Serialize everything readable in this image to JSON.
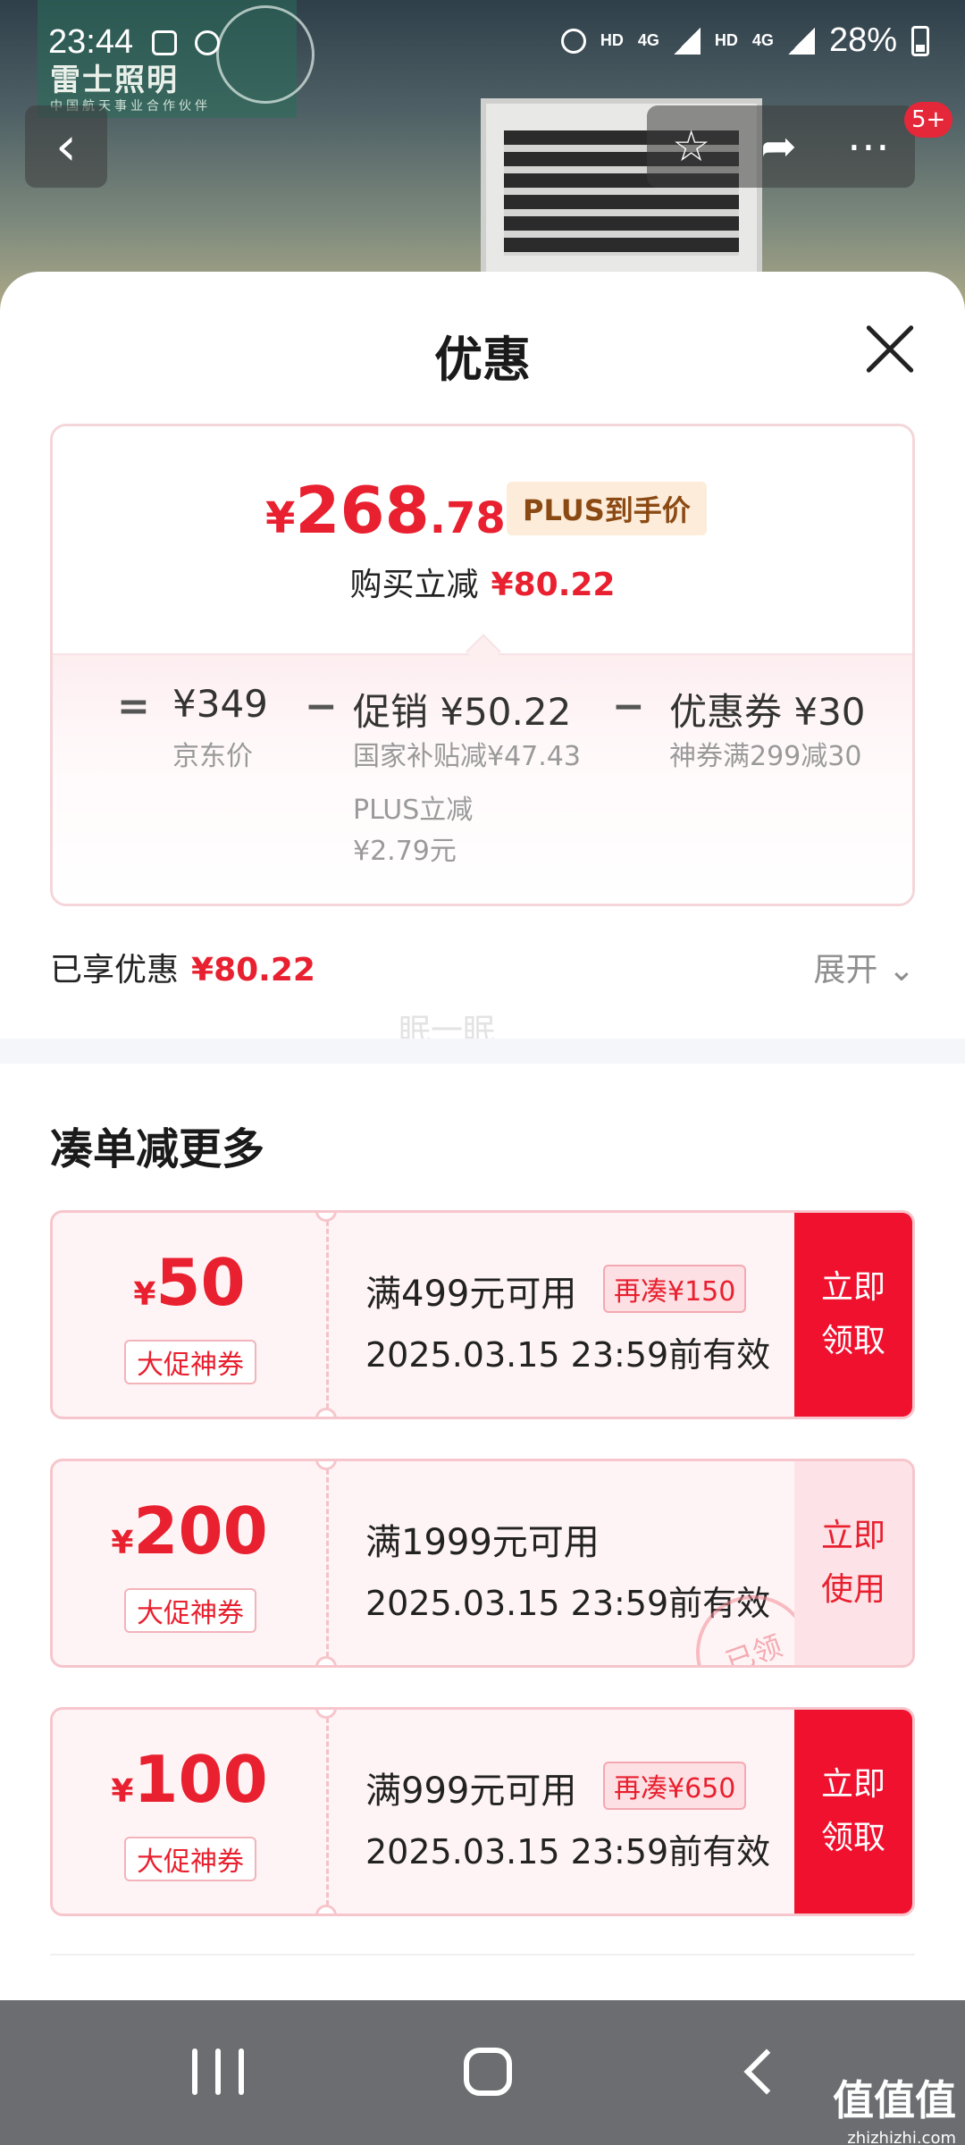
{
  "status_bar": {
    "time": "23:44",
    "network_1": "HD",
    "network_2": "4G",
    "network_3": "HD",
    "network_4": "4G",
    "battery": "28%"
  },
  "background": {
    "brand_logo": "雷士照明",
    "brand_tagline": "中国航天事业合作伙伴",
    "cart_badge": "5+"
  },
  "sheet": {
    "title": "优惠"
  },
  "price_card": {
    "yen": "¥",
    "final_price_int": "268",
    "final_price_dec": ".78",
    "plus_tag": "PLUS到手价",
    "saved_label": "购买立减",
    "saved_value": "¥80.22",
    "equals": "=",
    "minus": "−",
    "jd_price": "¥349",
    "jd_label": "京东价",
    "promo": "促销 ¥50.22",
    "promo_sub1": "国家补贴减¥47.43",
    "promo_sub2": "PLUS立减",
    "promo_sub3": "¥2.79元",
    "coupon": "优惠券 ¥30",
    "coupon_sub": "神券满299减30"
  },
  "enjoyed": {
    "label": "已享优惠",
    "value": "¥80.22",
    "expand": "展开"
  },
  "watermark": "眠一眠",
  "more_section": {
    "title": "凑单减更多",
    "coupons": [
      {
        "yen": "¥",
        "amount": "50",
        "tag": "大促神券",
        "condition": "满499元可用",
        "extra": "再凑¥150",
        "validity": "2025.03.15 23:59前有效",
        "action": "立即领取",
        "state": "claim"
      },
      {
        "yen": "¥",
        "amount": "200",
        "tag": "大促神券",
        "condition": "满1999元可用",
        "extra": "",
        "validity": "2025.03.15 23:59前有效",
        "action": "立即使用",
        "state": "claimed",
        "stamp": "已领"
      },
      {
        "yen": "¥",
        "amount": "100",
        "tag": "大促神券",
        "condition": "满999元可用",
        "extra": "再凑¥650",
        "validity": "2025.03.15 23:59前有效",
        "action": "立即领取",
        "state": "claim"
      }
    ]
  },
  "site_mark": {
    "name": "值值值",
    "url": "zhizhizhi.com"
  },
  "colors": {
    "accent_red": "#e8202f",
    "button_red": "#f0112f",
    "plus_tag_bg": "#fcecd9"
  },
  "icons": [
    "back-arrow-icon",
    "star-icon",
    "share-icon",
    "more-icon",
    "close-icon",
    "chevron-down-icon",
    "recents-icon",
    "home-icon",
    "back-icon"
  ]
}
